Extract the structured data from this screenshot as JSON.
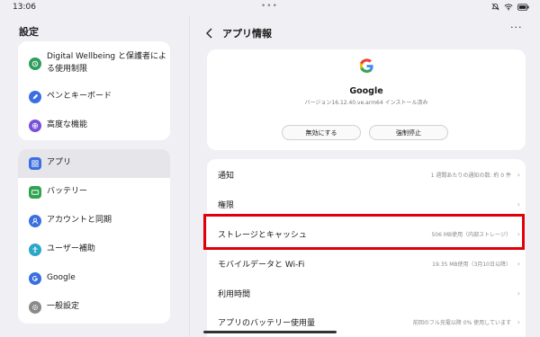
{
  "status": {
    "time": "13:06",
    "dots": "•••"
  },
  "left": {
    "title": "設定",
    "group1": [
      {
        "label_line1": "Digital Wellbeing と保護者によ",
        "label_line2": "る使用制限",
        "icon": "wellbeing-icon",
        "color": "#2e9d5a"
      },
      {
        "label": "ペンとキーボード",
        "icon": "pen-icon",
        "color": "#3b6fe0"
      },
      {
        "label": "高度な機能",
        "icon": "advanced-icon",
        "color": "#7a4fd8"
      }
    ],
    "group2": [
      {
        "label": "アプリ",
        "icon": "apps-icon",
        "color": "#3b6fe0",
        "active": true
      },
      {
        "label": "バッテリー",
        "icon": "battery-icon",
        "color": "#2ea44f"
      },
      {
        "label": "アカウントと同期",
        "icon": "account-icon",
        "color": "#3b6fe0"
      },
      {
        "label": "ユーザー補助",
        "icon": "accessibility-icon",
        "color": "#2aa7c9"
      },
      {
        "label": "Google",
        "icon": "google-icon",
        "color": "#3b6fe0"
      },
      {
        "label": "一般設定",
        "icon": "general-settings-icon",
        "color": "#8a8a8a"
      }
    ]
  },
  "right": {
    "title": "アプリ情報",
    "more": "···",
    "app": {
      "name": "Google",
      "version": "バージョン16.12.40.ve.arm64 インストール済み",
      "disable_label": "無効にする",
      "force_stop_label": "強制停止"
    },
    "rows": [
      {
        "label": "通知",
        "value": "1 週間あたりの通知の数: 約 0 件"
      },
      {
        "label": "権限",
        "value": ""
      },
      {
        "label": "ストレージとキャッシュ",
        "value": "506 MB使用（内部ストレージ）"
      },
      {
        "label": "モバイルデータと Wi-Fi",
        "value": "19.35 MB使用（3月10日以降）"
      },
      {
        "label": "利用時間",
        "value": ""
      },
      {
        "label": "アプリのバッテリー使用量",
        "value": "前回のフル充電以降 0% 使用しています"
      }
    ]
  },
  "colors": {
    "highlight": "#e0000b",
    "accent": "#3b6fe0"
  }
}
